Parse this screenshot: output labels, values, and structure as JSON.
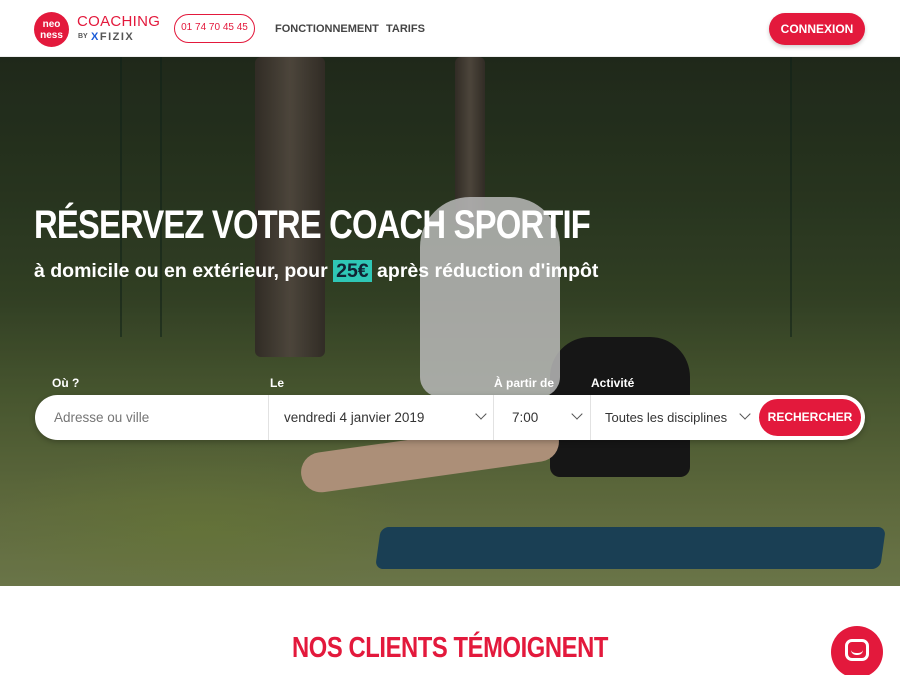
{
  "brand": {
    "logo_top": "neo",
    "logo_bottom": "ness",
    "coaching": "COACHING",
    "by": "BY",
    "fizix_x": "X",
    "fizix": "FIZIX",
    "accent_color": "#e3193c"
  },
  "header": {
    "phone": "01 74 70 45 45",
    "nav": [
      "FONCTIONNEMENT",
      "TARIFS"
    ],
    "login_label": "CONNEXION"
  },
  "hero": {
    "title": "RÉSERVEZ VOTRE COACH SPORTIF",
    "subtitle_before": "à domicile ou en extérieur, pour ",
    "price": "25€",
    "subtitle_after": " après réduction d'impôt"
  },
  "search": {
    "where_label": "Où ?",
    "where_placeholder": "Adresse ou ville",
    "date_label": "Le",
    "date_value": "vendredi 4 janvier 2019",
    "time_label": "À partir de",
    "time_value": "7:00",
    "activity_label": "Activité",
    "activity_value": "Toutes les disciplines",
    "button_label": "RECHERCHER"
  },
  "testimonials": {
    "title": "NOS CLIENTS TÉMOIGNENT"
  },
  "chat": {
    "icon": "chat-icon"
  }
}
